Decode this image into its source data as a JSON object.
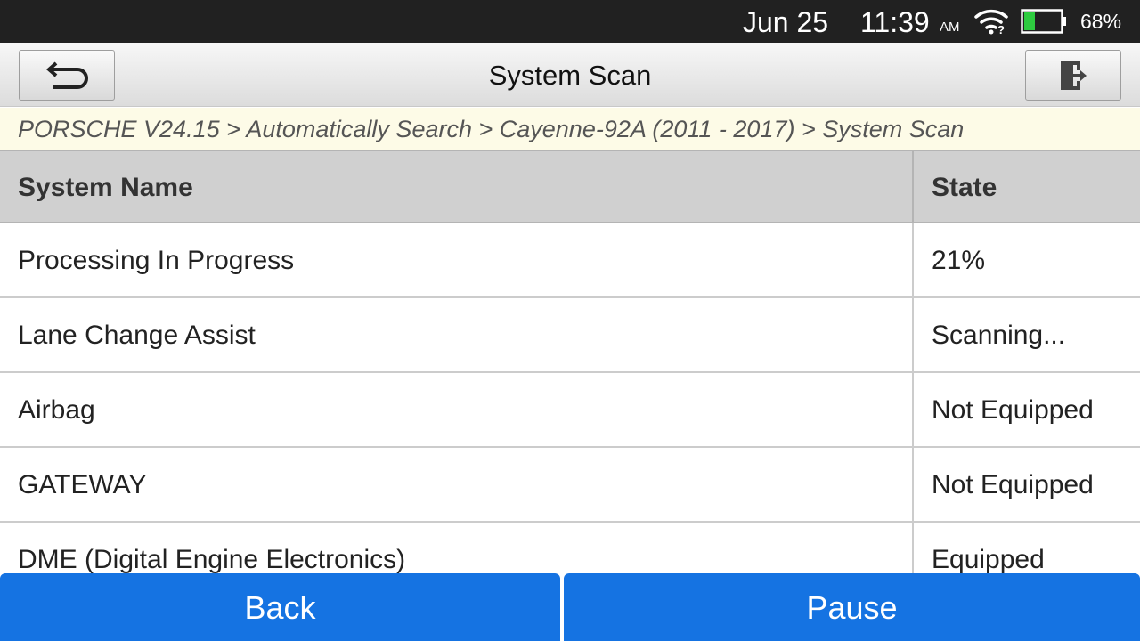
{
  "status_bar": {
    "date": "Jun 25",
    "time": "11:39",
    "ampm": "AM",
    "battery_percent": "68%",
    "battery_level": 0.68,
    "battery_color": "#2ecc40",
    "icons": [
      "wifi-icon",
      "battery-icon"
    ]
  },
  "title_bar": {
    "title": "System Scan",
    "back_icon": "back-arrow-icon",
    "exit_icon": "exit-icon"
  },
  "breadcrumb": "PORSCHE V24.15 > Automatically Search > Cayenne-92A (2011 - 2017) > System Scan",
  "table": {
    "headers": {
      "name": "System Name",
      "state": "State"
    },
    "rows": [
      {
        "name": "Processing In Progress",
        "state": "21%"
      },
      {
        "name": "Lane Change Assist",
        "state": "Scanning..."
      },
      {
        "name": "Airbag",
        "state": "Not Equipped"
      },
      {
        "name": "GATEWAY",
        "state": "Not Equipped"
      },
      {
        "name": "DME (Digital Engine Electronics)",
        "state": "Equipped"
      }
    ]
  },
  "buttons": {
    "back": "Back",
    "pause": "Pause"
  },
  "colors": {
    "accent": "#1573e2",
    "status_bar": "#212121",
    "breadcrumb_bg": "#fdfbe7",
    "header_bg": "#d0d0d0"
  }
}
